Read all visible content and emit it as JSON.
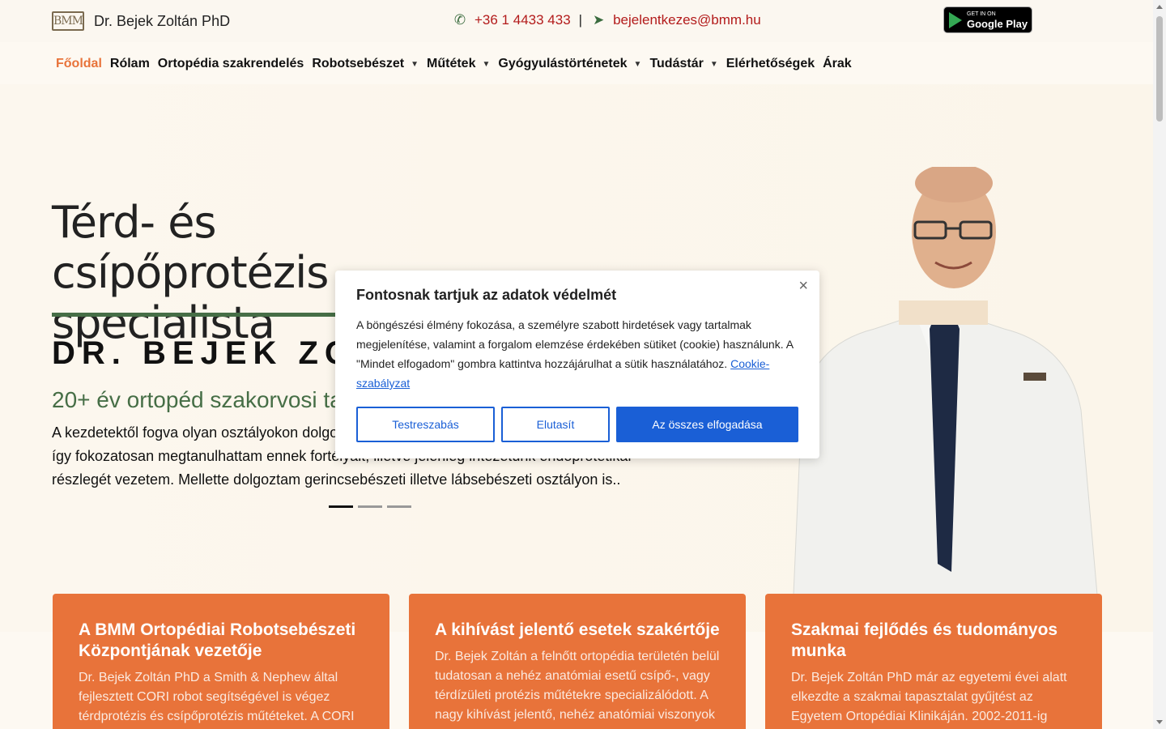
{
  "header": {
    "logo_mark": "BMM",
    "site_name": "Dr. Bejek Zoltán PhD",
    "phone": "+36 1 4433 433",
    "separator": "|",
    "email": "bejelentkezes@bmm.hu",
    "store_badge": {
      "small": "GET IN ON",
      "big": "Google Play"
    }
  },
  "nav": {
    "items": [
      {
        "label": "Főoldal",
        "active": true,
        "dropdown": false
      },
      {
        "label": "Rólam",
        "dropdown": false
      },
      {
        "label": "Ortopédia szakrendelés",
        "dropdown": false
      },
      {
        "label": "Robotsebészet",
        "dropdown": true
      },
      {
        "label": "Műtétek",
        "dropdown": true
      },
      {
        "label": "Gyógyulástörténetek",
        "dropdown": true
      },
      {
        "label": "Tudástár",
        "dropdown": true
      },
      {
        "label": "Elérhetőségek",
        "dropdown": false
      },
      {
        "label": "Árak",
        "dropdown": false
      }
    ]
  },
  "hero": {
    "title_line1": "Térd- és",
    "title_line2": "csípőprotézis specialista",
    "name": "DR. BEJEK ZOLTÁN",
    "subtitle": "20+ év ortopéd szakorvosi tapasztalat",
    "body": "A kezdetektől fogva olyan osztályokon dolgoztam, ahol az ortopédiai protetika volt a fő profil, így fokozatosan megtanulhattam ennek fortélyait, illetve jelenleg intézetünk endoprotetikai részlegét vezetem. Mellette dolgoztam gerincsebészeti illetve lábsebészeti osztályon is..",
    "slides": 3,
    "active_slide": 0
  },
  "cards": [
    {
      "title": "A BMM Ortopédiai Robotsebészeti Központjának vezetője",
      "text": "Dr. Bejek Zoltán PhD a Smith & Nephew által fejlesztett CORI robot segítségével is végez térdprotézis és csípőprotézis műtéteket. A CORI"
    },
    {
      "title": "A kihívást jelentő esetek szakértője",
      "text": "Dr. Bejek Zoltán a felnőtt ortopédia területén belül tudatosan a nehéz anatómiai esetű csípő-, vagy térdízületi protézis műtétekre specializálódott. A nagy kihívást jelentő, nehéz anatómiai viszonyok"
    },
    {
      "title": "Szakmai fejlődés és tudományos munka",
      "text": "Dr. Bejek Zoltán PhD már az egyetemi évei alatt elkezdte a szakmai tapasztalat gyűjtést az Egyetem Ortopédiai Klinikáján. 2002-2011-ig"
    }
  ],
  "cookie": {
    "title": "Fontosnak tartjuk az adatok védelmét",
    "message": "A böngészési élmény fokozása, a személyre szabott hirdetések vagy tartalmak megjelenítése, valamint a forgalom elemzése érdekében sütiket (cookie) használunk. A \"Mindet elfogadom\" gombra kattintva hozzájárulhat a sütik használatához.",
    "policy_link": "Cookie-szabályzat",
    "close": "×",
    "buttons": {
      "customize": "Testreszabás",
      "reject": "Elutasít",
      "accept_all": "Az összes elfogadása"
    }
  },
  "colors": {
    "accent_orange": "#e8733a",
    "green": "#466e46",
    "link_red": "#b31b1b",
    "cookie_blue": "#1a5fd6"
  },
  "icons": {
    "phone": "phone-icon",
    "email": "send-icon",
    "close": "close-icon",
    "caret": "chevron-down-icon"
  }
}
